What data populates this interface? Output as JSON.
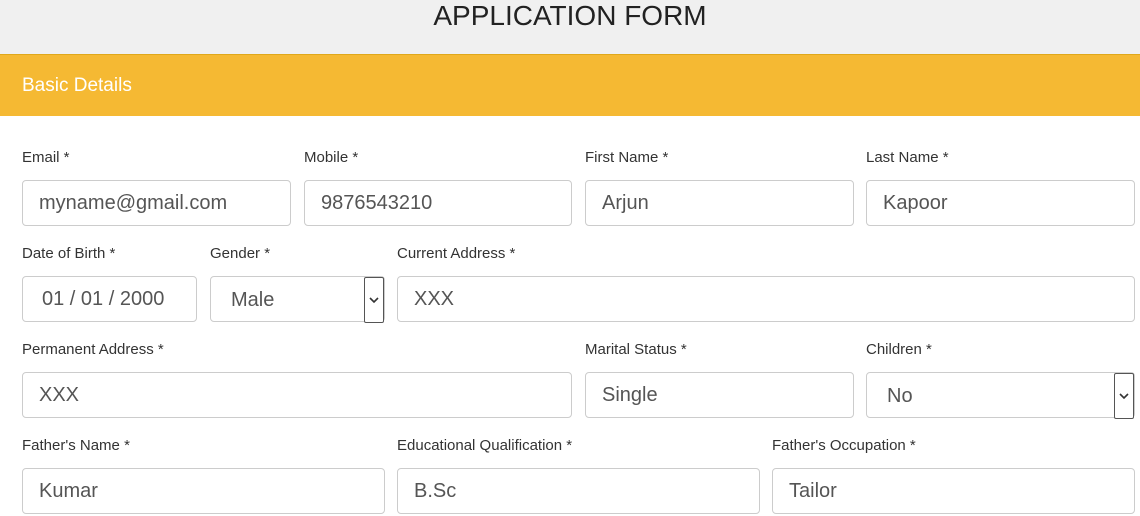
{
  "page": {
    "title": "APPLICATION FORM"
  },
  "section": {
    "title": "Basic Details",
    "color": "#f5b933"
  },
  "fields": {
    "email": {
      "label": "Email *",
      "value": "myname@gmail.com"
    },
    "mobile": {
      "label": "Mobile *",
      "value": "9876543210"
    },
    "first_name": {
      "label": "First Name *",
      "value": "Arjun"
    },
    "last_name": {
      "label": "Last Name *",
      "value": "Kapoor"
    },
    "dob": {
      "label": "Date of Birth *",
      "value": "01 / 01 / 2000"
    },
    "gender": {
      "label": "Gender *",
      "value": "Male",
      "icon": "chevron-down-icon"
    },
    "current_address": {
      "label": "Current Address *",
      "value": "XXX"
    },
    "permanent_address": {
      "label": "Permanent Address *",
      "value": "XXX"
    },
    "marital_status": {
      "label": "Marital Status *",
      "value": "Single"
    },
    "children": {
      "label": "Children *",
      "value": "No",
      "icon": "chevron-down-icon"
    },
    "fathers_name": {
      "label": "Father's Name *",
      "value": "Kumar"
    },
    "education": {
      "label": "Educational Qualification *",
      "value": "B.Sc"
    },
    "fathers_occupation": {
      "label": "Father's Occupation *",
      "value": "Tailor"
    }
  }
}
